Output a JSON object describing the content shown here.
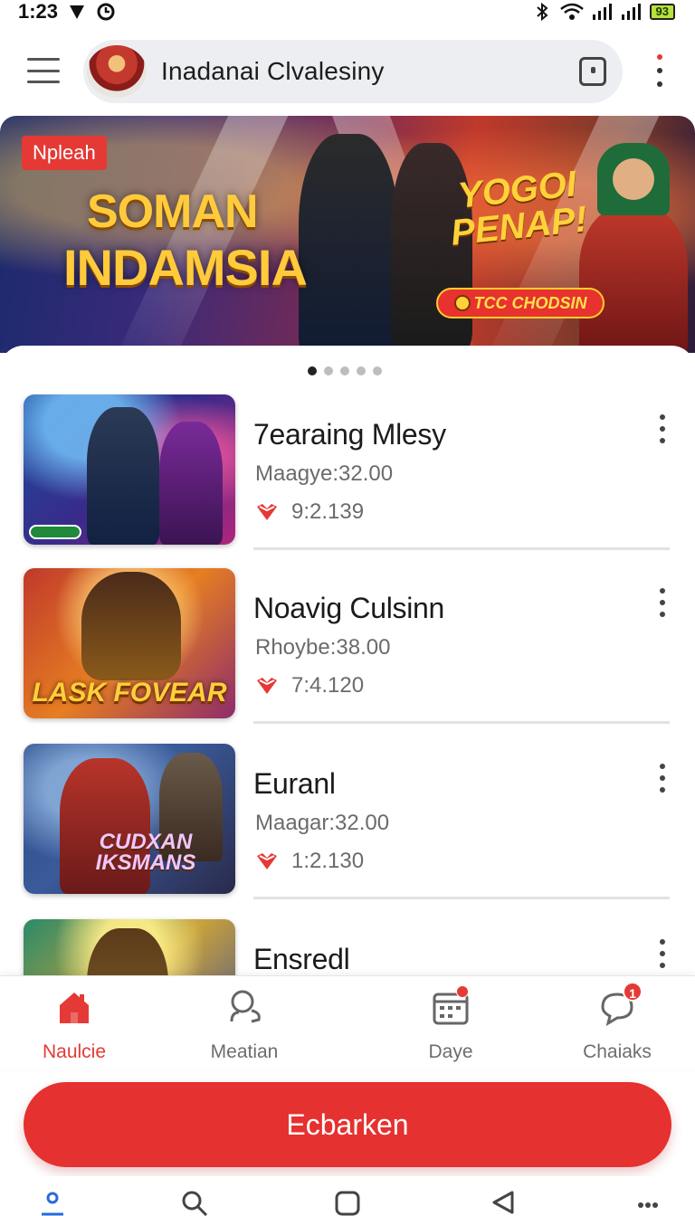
{
  "status": {
    "time": "1:23",
    "battery": "93"
  },
  "appbar": {
    "title": "Inadanai Clvalesiny"
  },
  "banner": {
    "tag": "Npleah",
    "headline_1": "SOMAN",
    "headline_2": "INDAMSIA",
    "promo_1": "YOGOI",
    "promo_2": "PENAP!",
    "badge": "TCC CHODSIN",
    "page_count": 5,
    "active_page": 1
  },
  "games": [
    {
      "title": "7earaing Mlesy",
      "subtitle": "Maagye:32.00",
      "stat": "9:2.139",
      "caption": ""
    },
    {
      "title": "Noavig Culsinn",
      "subtitle": "Rhoybe:38.00",
      "stat": "7:4.120",
      "caption": "LASK FOVEAR"
    },
    {
      "title": "Euranl",
      "subtitle": "Maagar:32.00",
      "stat": "1:2.130",
      "caption": "CUDXAN IKSMANS"
    },
    {
      "title": "Ensredl",
      "subtitle": "",
      "stat": "",
      "caption": ""
    }
  ],
  "nav": {
    "items": [
      {
        "label": "Naulcie",
        "icon": "home-icon"
      },
      {
        "label": "Meatian",
        "icon": "search-people-icon"
      },
      {
        "label": "Daye",
        "icon": "calendar-icon"
      },
      {
        "label": "Chaiaks",
        "icon": "chat-icon",
        "badge": "1"
      }
    ]
  },
  "cta": {
    "label": "Ecbarken"
  },
  "colors": {
    "accent": "#e5312f",
    "nav_active": "#e53935"
  }
}
